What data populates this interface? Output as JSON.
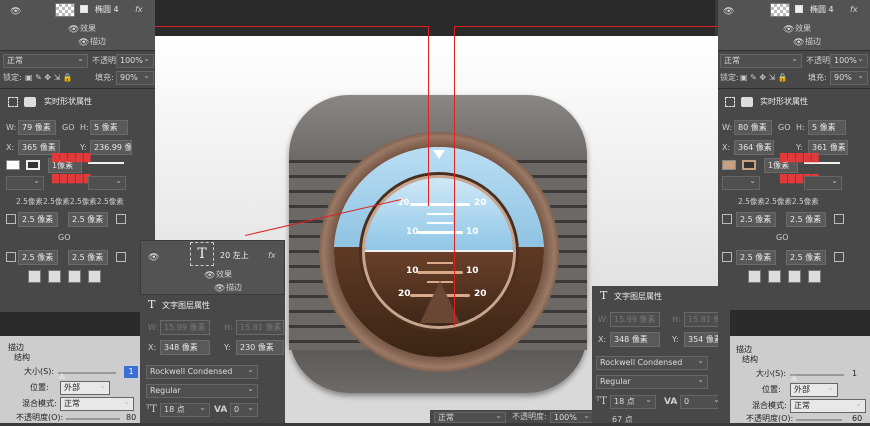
{
  "left_layers": {
    "layer_name": "椭圆 4",
    "effects": "效果",
    "stroke": "描边",
    "fx": "fx",
    "blend_mode": "正常",
    "opacity_label": "不透明度:",
    "opacity_value": "100%",
    "lock_label": "锁定:",
    "fill_label": "填充:",
    "fill_value": "90%"
  },
  "left_props": {
    "title": "实时形状属性",
    "w_label": "W:",
    "w_value": "79 像素",
    "link": "GO",
    "h_label": "H:",
    "h_value": "5 像素",
    "x_label": "X:",
    "x_value": "365 像素",
    "y_label": "Y:",
    "y_value": "236.99 像",
    "stroke_width": "1像素",
    "radius_row": [
      "2.5像素",
      "2.5像素",
      "2.5像素",
      "2.5像素"
    ],
    "corner_tl": "2.5 像素",
    "corner_tr": "2.5 像素",
    "corner_bl": "2.5 像素",
    "corner_br": "2.5 像素",
    "link2": "GO"
  },
  "middle_layer": {
    "name": "20 左上",
    "effects": "效果",
    "stroke": "描边",
    "fx": "fx"
  },
  "left_bottom": {
    "section": "描边",
    "structure": "结构",
    "size_label": "大小(S):",
    "size_value": "1",
    "position_label": "位置:",
    "position_value": "外部",
    "blend_label": "混合模式:",
    "blend_value": "正常",
    "opacity_label": "不透明度(O):",
    "opacity_value": "80"
  },
  "middle_text": {
    "title": "文字图层属性",
    "w_label": "W:",
    "w_value": "15.99 像素",
    "h_label": "H:",
    "h_value": "15.81 像素",
    "x_label": "X:",
    "x_value": "348 像素",
    "y_label": "Y:",
    "y_value": "230 像素",
    "font": "Rockwell Condensed",
    "style": "Regular",
    "size": "18 点",
    "tracking": "0"
  },
  "right_text": {
    "title": "文字图层属性",
    "w_label": "W:",
    "w_value": "15.99 像素",
    "h_label": "H:",
    "h_value": "15.81 像素",
    "x_label": "X:",
    "x_value": "348 像素",
    "y_label": "Y:",
    "y_value": "354 像素",
    "font": "Rockwell Condensed",
    "style": "Regular",
    "size": "18 点",
    "tracking": "0",
    "bottom_partial": "67 点"
  },
  "bottom_center": {
    "blend": "正常",
    "opacity_label": "不透明度:",
    "opacity_value": "100%"
  },
  "right_layers": {
    "layer_name": "椭圆 4",
    "effects": "效果",
    "stroke": "描边",
    "fx": "fx",
    "blend_mode": "正常",
    "opacity_label": "不透明度:",
    "opacity_value": "100%",
    "lock_label": "锁定:",
    "fill_label": "填充:",
    "fill_value": "90%"
  },
  "right_props": {
    "title": "实时形状属性",
    "w_label": "W:",
    "w_value": "80 像素",
    "link": "GO",
    "h_label": "H:",
    "h_value": "5 像素",
    "x_label": "X:",
    "x_value": "364 像素",
    "y_label": "Y:",
    "y_value": "361 像素",
    "stroke_width": "1像素",
    "radius_row": [
      "2.5像素",
      "2.5像素",
      "2.5像素"
    ],
    "corner_tl": "2.5 像素",
    "corner_tr": "2.5 像素",
    "corner_bl": "2.5 像素",
    "corner_br": "2.5 像素",
    "link2": "GO"
  },
  "right_bottom": {
    "section": "描边",
    "structure": "结构",
    "size_label": "大小(S):",
    "size_value": "1",
    "position_label": "位置:",
    "position_value": "外部",
    "blend_label": "混合模式:",
    "blend_value": "正常",
    "opacity_label": "不透明度(O):",
    "opacity_value": "60"
  },
  "gauge": {
    "sky_labels": [
      "20",
      "20",
      "10",
      "10"
    ],
    "ground_labels": [
      "10",
      "10",
      "20",
      "20"
    ]
  },
  "colors": {
    "panel": "#484848",
    "accent_red": "#e23a3a",
    "sky": "#a9d3ec",
    "ground": "#5a3621",
    "bezel": "#7a5744",
    "icon_body": "#5e5b59",
    "left_fill_swatch": "#ffffff",
    "right_fill_swatch": "#c8a080"
  }
}
